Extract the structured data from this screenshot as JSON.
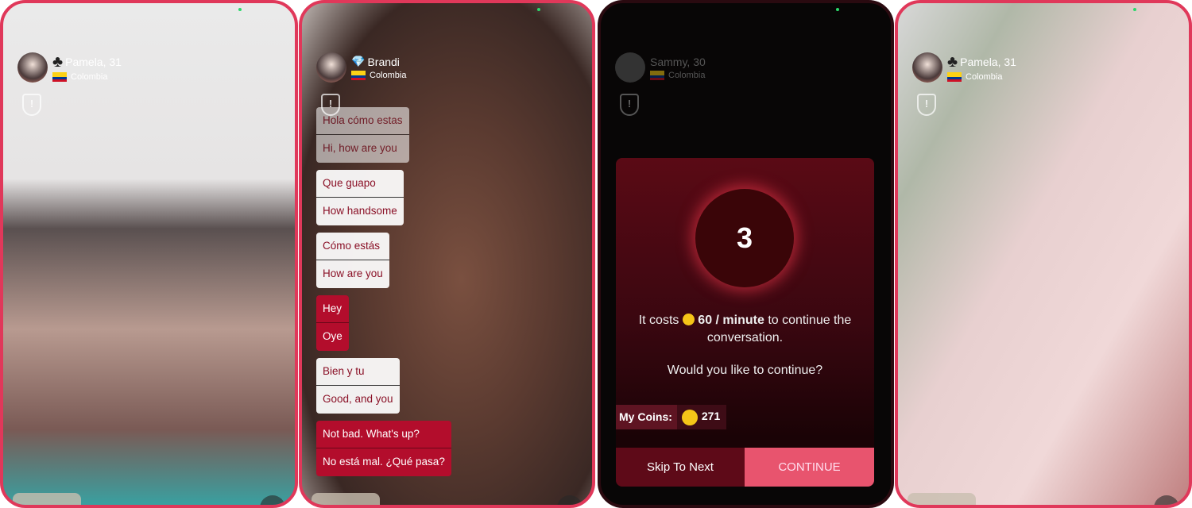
{
  "panels": [
    {
      "name": "Pamela, 31",
      "country": "Colombia",
      "badge": "club-icon"
    },
    {
      "name": "Brandi",
      "country": "Colombia",
      "badge": "diamond-icon"
    },
    {
      "name": "Sammy, 30",
      "country": "Colombia"
    },
    {
      "name": "Pamela, 31",
      "country": "Colombia",
      "badge": "club-icon"
    }
  ],
  "chat": [
    {
      "a": "Hola cómo estas",
      "b": "Hi, how are you",
      "style": "white",
      "faded": true
    },
    {
      "a": "Que guapo",
      "b": "How handsome",
      "style": "white"
    },
    {
      "a": "Cómo estás",
      "b": "How are you",
      "style": "white"
    },
    {
      "a": "Hey",
      "b": "Oye",
      "style": "red"
    },
    {
      "a": "Bien y tu",
      "b": "Good, and you",
      "style": "white"
    },
    {
      "a": "Not bad. What's up?",
      "b": "No está mal. ¿Qué pasa?",
      "style": "red"
    }
  ],
  "modal": {
    "countdown": "3",
    "cost_prefix": "It costs",
    "cost_amount": "60 / minute",
    "cost_suffix": "to continue the conversation.",
    "question": "Would you like to continue?",
    "coins_label": "My Coins:",
    "coins_value": "271",
    "skip_label": "Skip To Next",
    "continue_label": "CONTINUE"
  },
  "colors": {
    "accent": "#e0385a",
    "continue": "#e8546e",
    "bubble_red": "#b30d2c",
    "coin": "#f5c518"
  }
}
